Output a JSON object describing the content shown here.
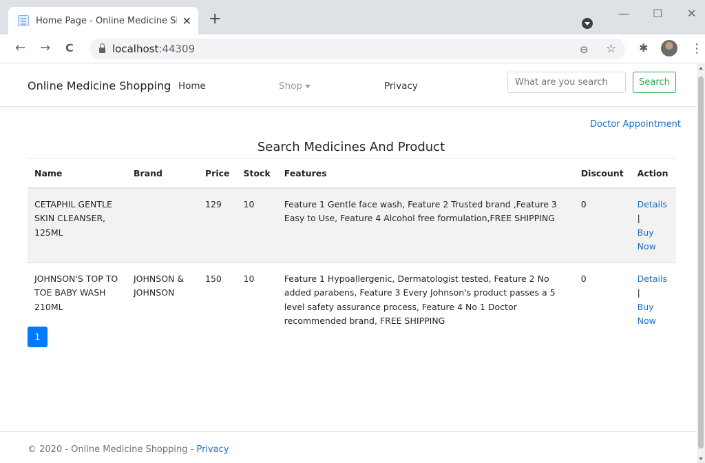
{
  "browser": {
    "tab_title": "Home Page - Online Medicine Shopping",
    "tab_close": "✕",
    "new_tab": "+",
    "url_host": "localhost",
    "url_port": ":44309",
    "back": "←",
    "forward": "→",
    "reload": "C",
    "zoom_icon": "⊖",
    "star_icon": "☆",
    "extensions_icon": "✱",
    "menu_icon": "⋮",
    "minimize": "—",
    "maximize": "☐",
    "close": "✕"
  },
  "site_nav": {
    "brand": "Online Medicine Shopping",
    "home": "Home",
    "shop": "Shop",
    "privacy": "Privacy",
    "search_placeholder": "What are you search",
    "search_button": "Search"
  },
  "main": {
    "doctor_link": "Doctor Appointment",
    "heading": "Search Medicines And Product",
    "columns": [
      "Name",
      "Brand",
      "Price",
      "Stock",
      "Features",
      "Discount",
      "Action"
    ],
    "rows": [
      {
        "name": "CETAPHIL GENTLE SKIN CLEANSER, 125ML",
        "brand": "",
        "price": "129",
        "stock": "10",
        "features": "Feature 1 Gentle face wash, Feature 2 Trusted brand ,Feature 3 Easy to Use, Feature 4 Alcohol free formulation,FREE SHIPPING",
        "discount": "0",
        "details": "Details",
        "sep": "|",
        "buy": "Buy Now"
      },
      {
        "name": "JOHNSON'S TOP TO TOE BABY WASH 210ML",
        "brand": "JOHNSON & JOHNSON",
        "price": "150",
        "stock": "10",
        "features": "Feature 1 Hypoallergenic, Dermatologist tested, Feature 2 No added parabens, Feature 3 Every Johnson's product passes a 5 level safety assurance process, Feature 4 No 1 Doctor recommended brand, FREE SHIPPING",
        "discount": "0",
        "details": "Details",
        "sep": "|",
        "buy": "Buy Now"
      }
    ],
    "page": "1"
  },
  "footer": {
    "text": "© 2020 - Online Medicine Shopping - ",
    "privacy": "Privacy"
  },
  "colors": {
    "link": "#1b6ec2",
    "success": "#28a745",
    "primary": "#007bff"
  }
}
